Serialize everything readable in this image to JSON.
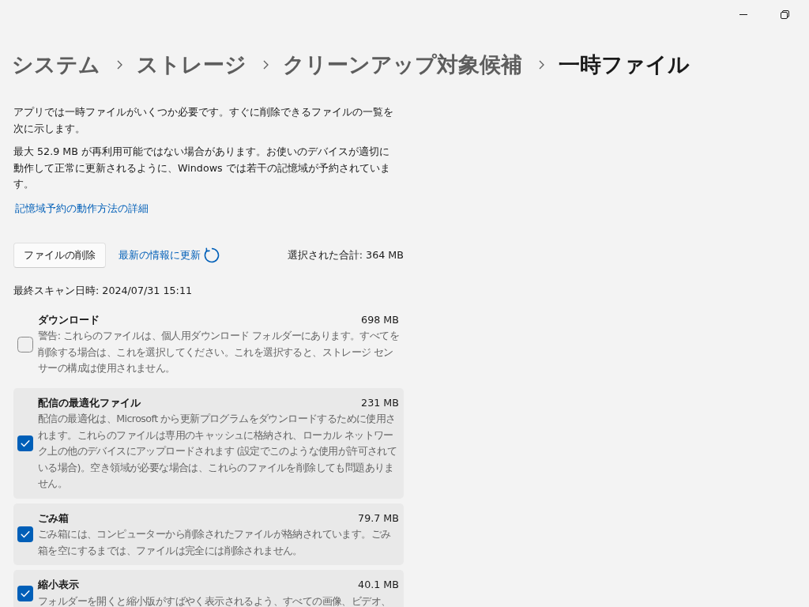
{
  "breadcrumb": [
    {
      "label": "システム",
      "current": false
    },
    {
      "label": "ストレージ",
      "current": false
    },
    {
      "label": "クリーンアップ対象候補",
      "current": false
    },
    {
      "label": "一時ファイル",
      "current": true
    }
  ],
  "intro": [
    "アプリでは一時ファイルがいくつか必要です。すぐに削除できるファイルの一覧を次に示します。",
    "最大 52.9 MB が再利用可能ではない場合があります。お使いのデバイスが適切に動作して正常に更新されるように、Windows では若干の記憶域が予約されています。"
  ],
  "learn_more_link": "記憶域予約の動作方法の詳細",
  "actions": {
    "remove_button": "ファイルの削除",
    "refresh_link": "最新の情報に更新",
    "selected_total": "選択された合計: 364 MB"
  },
  "last_scan": "最終スキャン日時: 2024/07/31 15:11",
  "categories": [
    {
      "name": "ダウンロード",
      "size": "698 MB",
      "checked": false,
      "description": "警告: これらのファイルは、個人用ダウンロード フォルダーにあります。すべてを削除する場合は、これを選択してください。これを選択すると、ストレージ センサーの構成は使用されません。"
    },
    {
      "name": "配信の最適化ファイル",
      "size": "231 MB",
      "checked": true,
      "description": "配信の最適化は、Microsoft から更新プログラムをダウンロードするために使用されます。これらのファイルは専用のキャッシュに格納され、ローカル ネットワーク上の他のデバイスにアップロードされます (設定でこのような使用が許可されている場合)。空き領域が必要な場合は、これらのファイルを削除しても問題ありません。"
    },
    {
      "name": "ごみ箱",
      "size": "79.7 MB",
      "checked": true,
      "description": "ごみ箱には、コンピューターから削除されたファイルが格納されています。ごみ箱を空にするまでは、ファイルは完全には削除されません。"
    },
    {
      "name": "縮小表示",
      "size": "40.1 MB",
      "checked": true,
      "description": "フォルダーを開くと縮小版がすばやく表示されるよう、すべての画像、ビデオ、"
    }
  ]
}
